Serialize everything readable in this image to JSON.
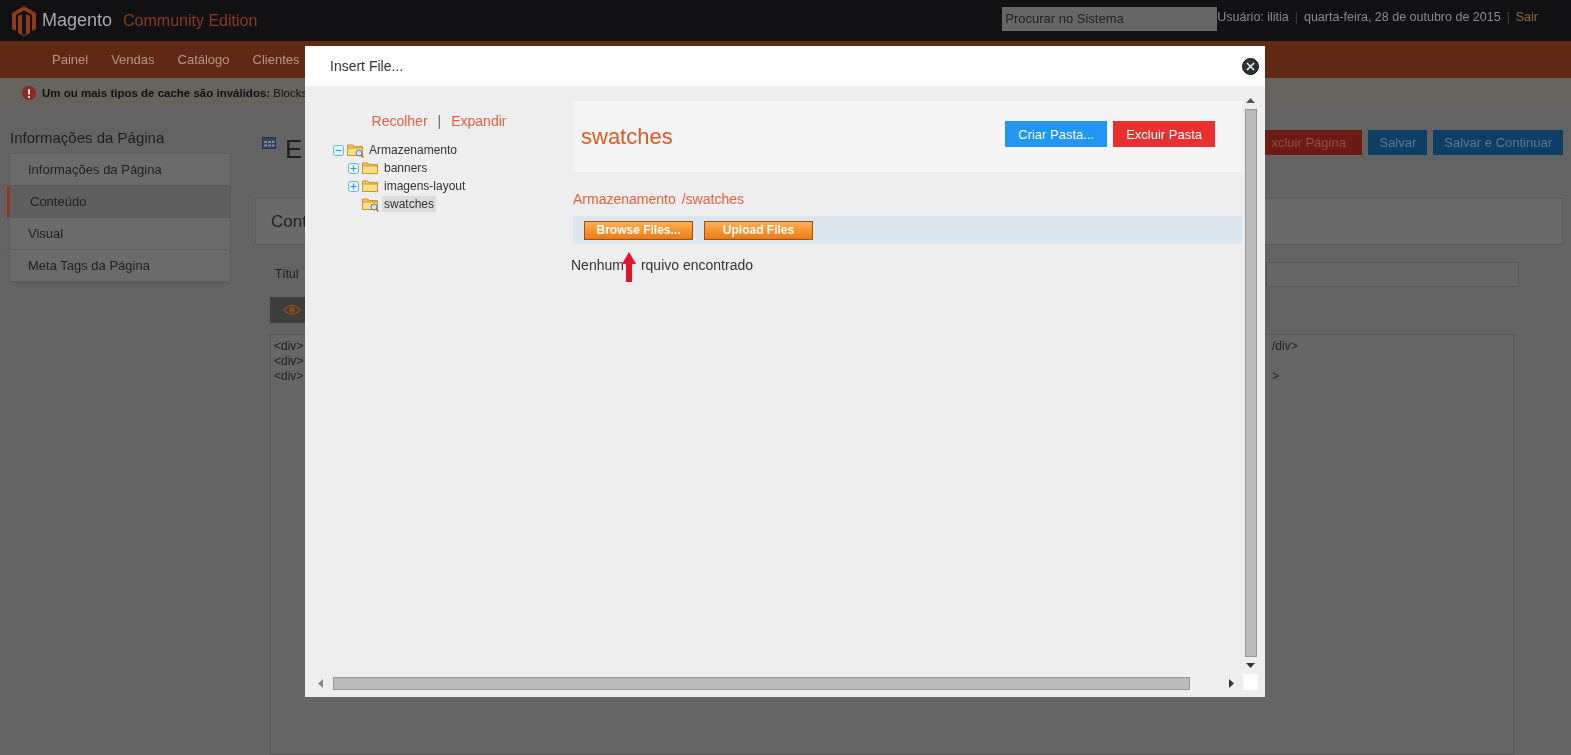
{
  "header": {
    "logo_text": "Magento",
    "edition": "Community Edition",
    "search": {
      "placeholder": "Procurar no Sistema"
    },
    "user": "Usuário: ilitia",
    "separator_1": "|",
    "date": "quarta-feira, 28 de outubro de 2015",
    "separator_2": "|",
    "logout": "Sair"
  },
  "nav": {
    "items": [
      "Painel",
      "Vendas",
      "Catálogo",
      "Clientes"
    ]
  },
  "notice": {
    "text": "**Um ou mais tipos de cache são inválidos:** Blocks"
  },
  "sidebar": {
    "title": "Informações da Página",
    "tabs": [
      {
        "label": "Informações da Página",
        "selected": false
      },
      {
        "label": "Conteúdo",
        "selected": true
      },
      {
        "label": "Visual",
        "selected": false
      },
      {
        "label": "Meta Tags da Página",
        "selected": false
      }
    ]
  },
  "page": {
    "title": "E",
    "actions": [
      {
        "label": "xcluir Página",
        "kind": "danger"
      },
      {
        "label": "Salvar",
        "kind": "primary"
      },
      {
        "label": "Salvar e Continuar",
        "kind": "primary"
      }
    ],
    "section_title": "Cont",
    "field_label": "Títul",
    "editor_lines": [
      {
        "left": "<div>",
        "right": "/div>"
      },
      {
        "left": "<div>"
      },
      {
        "left": "<div>",
        "right": ">"
      }
    ]
  },
  "dialog": {
    "title": "Insert File...",
    "tree_actions": [
      "Recolher",
      "Expandir"
    ],
    "tree_actions_separator": "|",
    "tree": [
      {
        "label": "Armazenamento",
        "expanded": true,
        "selected": false,
        "children": [
          {
            "label": "banners",
            "expanded": false,
            "selected": false
          },
          {
            "label": "imagens-layout",
            "expanded": false,
            "selected": false
          },
          {
            "label": "swatches",
            "selected": true
          }
        ]
      }
    ],
    "folder_title": "swatches",
    "folder_actions": [
      {
        "label": "Criar Pasta...",
        "kind": "create"
      },
      {
        "label": "Excluir Pasta",
        "kind": "delete"
      }
    ],
    "breadcrumb": [
      "Armazenamento",
      "/swatches"
    ],
    "file_actions": [
      "Browse Files...",
      "Upload Files"
    ],
    "empty_message": [
      "Nenhum",
      "rquivo encontrado"
    ]
  }
}
